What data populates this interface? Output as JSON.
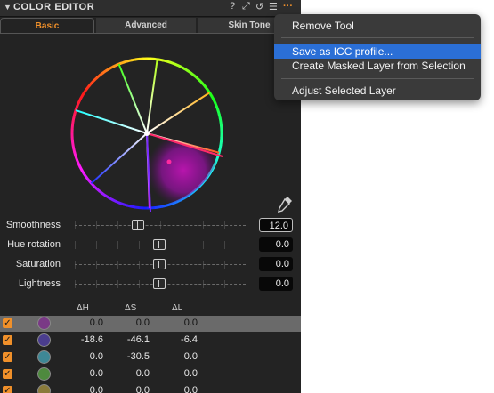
{
  "tool": {
    "title": "COLOR EDITOR",
    "collapse_icon": "triangle-down-icon",
    "header_icons": [
      "help-icon",
      "picker-icon",
      "reset-icon",
      "list-icon",
      "more-icon"
    ],
    "header_glyphs": {
      "help": "?",
      "picker": "⤢",
      "reset": "↺",
      "list": "☰",
      "more": "···"
    }
  },
  "tabs": [
    {
      "label": "Basic",
      "active": true
    },
    {
      "label": "Advanced",
      "active": false
    },
    {
      "label": "Skin Tone",
      "active": false
    }
  ],
  "colors": {
    "accent": "#f0902a",
    "menu_highlight": "#2b6fd6",
    "panel_bg": "#232323"
  },
  "sliders": [
    {
      "label": "Smoothness",
      "value": "12.0",
      "position": 0.375,
      "active": true
    },
    {
      "label": "Hue rotation",
      "value": "0.0",
      "position": 0.5,
      "active": false
    },
    {
      "label": "Saturation",
      "value": "0.0",
      "position": 0.5,
      "active": false
    },
    {
      "label": "Lightness",
      "value": "0.0",
      "position": 0.5,
      "active": false
    }
  ],
  "table": {
    "headers": [
      "ΔH",
      "ΔS",
      "ΔL"
    ],
    "rows": [
      {
        "swatch": "#7a3a86",
        "dh": "0.0",
        "ds": "0.0",
        "dl": "0.0",
        "selected": true,
        "checked": true
      },
      {
        "swatch": "#4a3d8e",
        "dh": "-18.6",
        "ds": "-46.1",
        "dl": "-6.4",
        "selected": false,
        "checked": true
      },
      {
        "swatch": "#3e8896",
        "dh": "0.0",
        "ds": "-30.5",
        "dl": "0.0",
        "selected": false,
        "checked": true
      },
      {
        "swatch": "#4e8a3e",
        "dh": "0.0",
        "ds": "0.0",
        "dl": "0.0",
        "selected": false,
        "checked": true
      },
      {
        "swatch": "#8a7a3a",
        "dh": "0.0",
        "ds": "0.0",
        "dl": "0.0",
        "selected": false,
        "checked": true
      }
    ]
  },
  "menu": {
    "items": [
      {
        "label": "Remove Tool",
        "highlighted": false
      },
      {
        "label": "Save as ICC profile...",
        "highlighted": true
      },
      {
        "label": "Create Masked Layer from Selection",
        "highlighted": false
      },
      {
        "label": "Adjust Selected Layer",
        "highlighted": false
      }
    ]
  }
}
